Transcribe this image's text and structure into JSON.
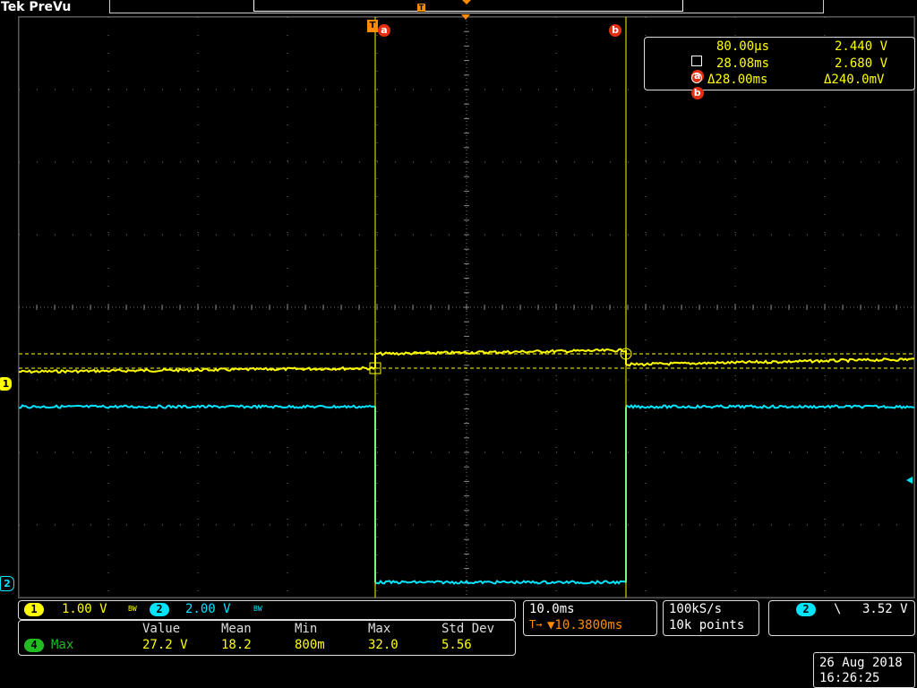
{
  "brand": {
    "tek": "Tek",
    "mode": "PreVu"
  },
  "cursor_markers": {
    "a": "a",
    "b": "b",
    "t": "T"
  },
  "channel_markers": {
    "ch1": "1",
    "ch2": "2"
  },
  "cursor_readout": {
    "a_time": "80.00µs",
    "a_volt": "2.440 V",
    "b_time": "28.08ms",
    "b_volt": "2.680 V",
    "delta_time": "Δ28.00ms",
    "delta_volt": "Δ240.0mV"
  },
  "channels": {
    "ch1": {
      "label": "1",
      "scale": "1.00 V",
      "color": "#ffff00"
    },
    "ch2": {
      "label": "2",
      "scale": "2.00 V",
      "color": "#00e5ff"
    },
    "bw_symbol": "BW"
  },
  "measurement": {
    "channel": "4",
    "name": "Max",
    "headers": [
      "Value",
      "Mean",
      "Min",
      "Max",
      "Std Dev"
    ],
    "values": [
      "27.2 V",
      "18.2",
      "800m",
      "32.0",
      "5.56"
    ],
    "badge_color": "#22bb22"
  },
  "timebase": {
    "scale": "10.0ms",
    "trigger_pos": "▼10.3800ms",
    "trig_icon": "T→"
  },
  "acquisition": {
    "rate": "100kS/s",
    "points": "10k points"
  },
  "trigger": {
    "source": "2",
    "slope": "\\",
    "level": "3.52 V"
  },
  "datetime": {
    "date": "26 Aug 2018",
    "time": "16:26:25"
  },
  "colors": {
    "ch1": "#ffff00",
    "ch2": "#00e5ff",
    "cursor": "#ffff00",
    "grid": "#888888"
  }
}
